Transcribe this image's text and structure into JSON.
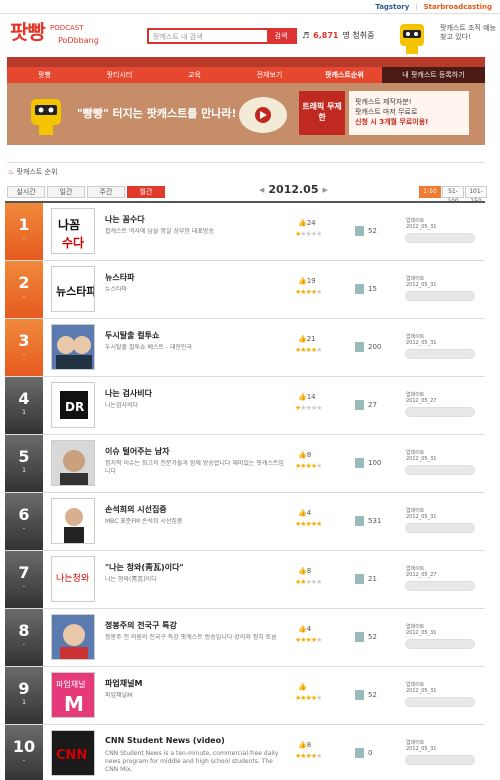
{
  "topbar": {
    "link1": "Tagstory",
    "sep": "|",
    "link2": "Starbroadcasting"
  },
  "logo": {
    "main": "팟빵",
    "sub": "PODCAST",
    "brand": "PoDbbang"
  },
  "search": {
    "placeholder": "팟캐스트 내 검색",
    "button": "검색"
  },
  "stat": {
    "count": "6,871",
    "label": "명 청취중"
  },
  "mascot_note": "팟캐스트 조직 예능찾고 있다!",
  "nav": {
    "items": [
      "팟빵",
      "팟티시터",
      "교육",
      "전체보기",
      "팟캐스트순위"
    ],
    "right": "내 팟캐스트 등록하기"
  },
  "banner": {
    "text": "\"빵빵\" 터지는 팟캐스트를 만나라!",
    "box": "트래픽 무제한",
    "promo_line1": "팟캐스트 제작자분!",
    "promo_line2": "팟캐스트 마저 무료로",
    "promo_line3": "신청 시 3개월 무료이용!"
  },
  "section_title": "팟캐스트 순위",
  "tabs": [
    "실시간",
    "일간",
    "주간",
    "월간"
  ],
  "date": {
    "prev": "◀",
    "value": "2012.05",
    "next": "▶"
  },
  "pager": [
    "1-50",
    "51-100",
    "101-150"
  ],
  "rows": [
    {
      "rank": "1",
      "change": "-",
      "title": "나는 꼼수다",
      "desc": "팝캐스트 역사에 남을 명실 상부한 대표방송",
      "likes": "24",
      "stars": "★★★★★",
      "stars_on": 1,
      "episodes": "52",
      "date": "2012_05_31",
      "updated": "업데이트"
    },
    {
      "rank": "2",
      "change": "-",
      "title": "뉴스타파",
      "desc": "뉴스타파",
      "likes": "19",
      "stars": "★★★★★",
      "stars_on": 4,
      "episodes": "15",
      "date": "2012_05_31",
      "updated": "업데이트"
    },
    {
      "rank": "3",
      "change": "-",
      "title": "두시탈출 컬투쇼",
      "desc": "두시탈출 컬투쇼 베스트 - 대한민국",
      "likes": "21",
      "stars": "★★★★★",
      "stars_on": 4,
      "episodes": "200",
      "date": "2012_05_31",
      "updated": "업데이트"
    },
    {
      "rank": "4",
      "change": "1",
      "title": "나는 검사비다",
      "desc": "나는검사비다",
      "likes": "14",
      "stars": "★★★★★",
      "stars_on": 1,
      "episodes": "27",
      "date": "2012_05_27",
      "updated": "업데이트"
    },
    {
      "rank": "5",
      "change": "1",
      "title": "이슈 털어주는 남자",
      "desc": "정치적 이슈는 최고의 전문가들과 함께 방송합니다 재미있는 팟캐스트입니다",
      "likes": "8",
      "stars": "★★★★★",
      "stars_on": 4,
      "episodes": "100",
      "date": "2012_05_31",
      "updated": "업데이트"
    },
    {
      "rank": "6",
      "change": "-",
      "title": "손석희의 시선집중",
      "desc": "MBC 표준FM 손석희 시선집중",
      "likes": "4",
      "stars": "★★★★★",
      "stars_on": 5,
      "episodes": "531",
      "date": "2012_05_31",
      "updated": "업데이트"
    },
    {
      "rank": "7",
      "change": "-",
      "title": "\"나는 청와(靑瓦)이다\"",
      "desc": "나는 청와(靑瓦)이다",
      "likes": "8",
      "stars": "★★★★★",
      "stars_on": 2,
      "episodes": "21",
      "date": "2012_05_27",
      "updated": "업데이트"
    },
    {
      "rank": "8",
      "change": "-",
      "title": "정봉주의 전국구 특강",
      "desc": "정봉주 전 의원의 전국구 특강 팟캐스트 방송입니다 강의와 정치 토론",
      "likes": "4",
      "stars": "★★★★★",
      "stars_on": 4,
      "episodes": "52",
      "date": "2012_05_31",
      "updated": "업데이트"
    },
    {
      "rank": "9",
      "change": "1",
      "title": "파업채널M",
      "desc": "파업채널M",
      "likes": "",
      "stars": "★★★★★",
      "stars_on": 4,
      "episodes": "52",
      "date": "2012_05_31",
      "updated": "업데이트"
    },
    {
      "rank": "10",
      "change": "-",
      "title": "CNN Student News (video)",
      "desc": "CNN Student News is a ten-minute, commercial-free daily news program for middle and high school students. The CNN Mix.",
      "likes": "8",
      "stars": "★★★★★",
      "stars_on": 4,
      "episodes": "0",
      "date": "2012_05_31",
      "updated": "업데이트"
    }
  ],
  "colors": {
    "accent": "#e2362a",
    "orange": "#f07a30",
    "rank_top": "#e55a20",
    "rank_rest": "#333333"
  }
}
